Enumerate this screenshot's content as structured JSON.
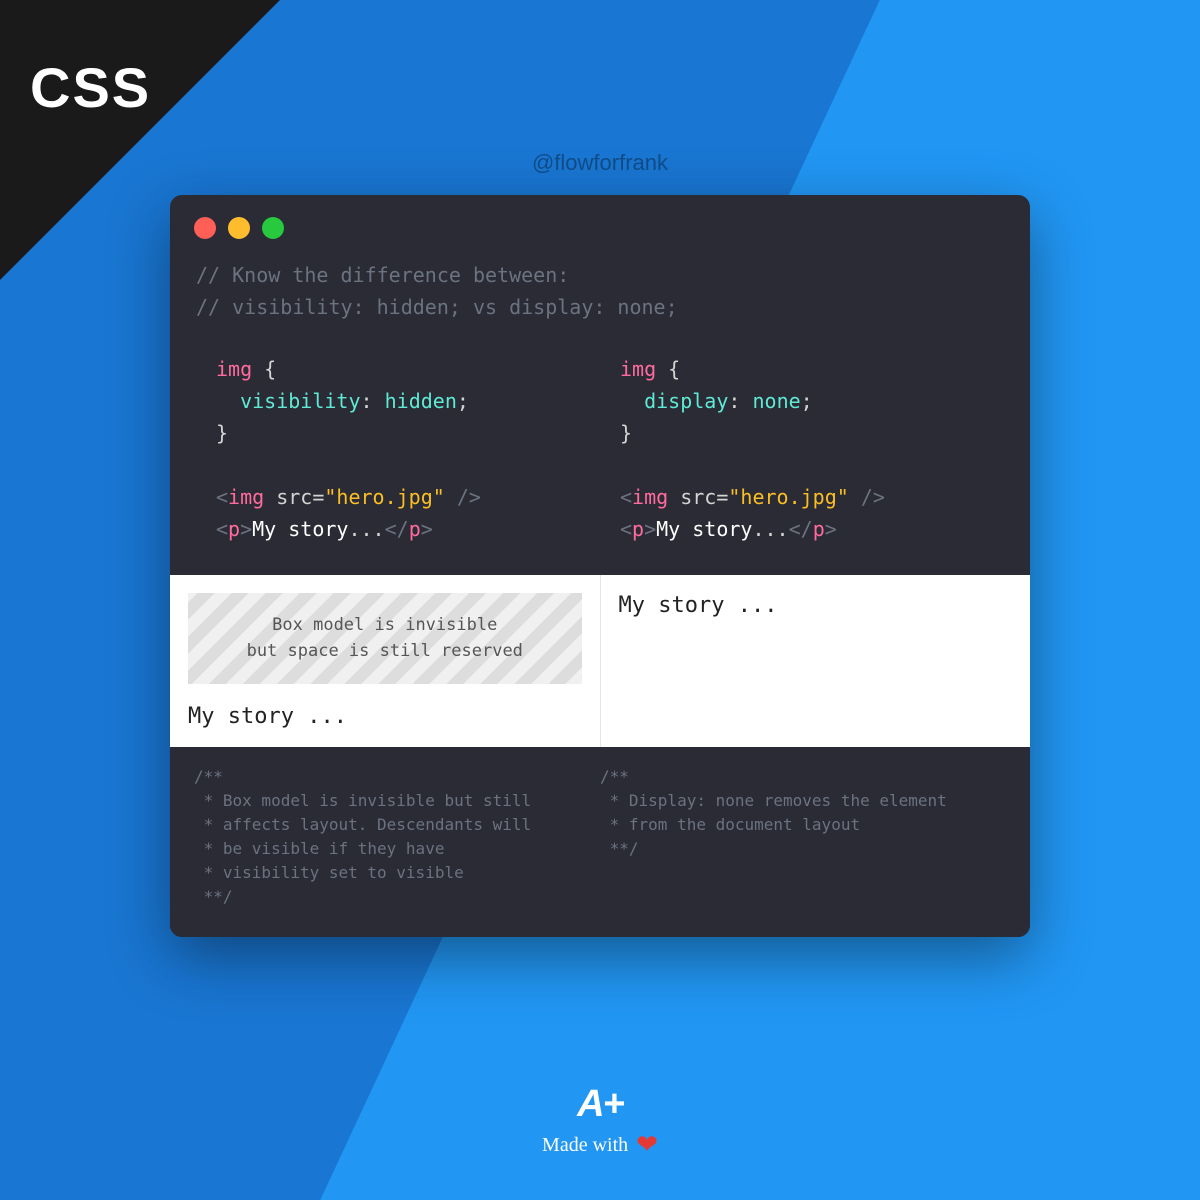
{
  "badge": "CSS",
  "handle": "@flowforfrank",
  "comments": {
    "line1": "// Know the difference between:",
    "line2": "// visibility: hidden; vs display: none;"
  },
  "left": {
    "selector": "img",
    "prop": "visibility",
    "value": "hidden",
    "img_tag": "img",
    "img_attr": "src",
    "img_val": "\"hero.jpg\"",
    "p_tag": "p",
    "p_text": "My story",
    "dots": "..."
  },
  "right": {
    "selector": "img",
    "prop": "display",
    "value": "none",
    "img_tag": "img",
    "img_attr": "src",
    "img_val": "\"hero.jpg\"",
    "p_tag": "p",
    "p_text": "My story",
    "dots": "..."
  },
  "output": {
    "placeholder_l1": "Box model is invisible",
    "placeholder_l2": "but space is still reserved",
    "left_text": "My story ...",
    "right_text": "My story ..."
  },
  "notes": {
    "left": "/**\n * Box model is invisible but still\n * affects layout. Descendants will\n * be visible if they have\n * visibility set to visible\n **/",
    "right": "/**\n * Display: none removes the element\n * from the document layout\n **/"
  },
  "footer": {
    "logo": "A+",
    "made": "Made with"
  }
}
